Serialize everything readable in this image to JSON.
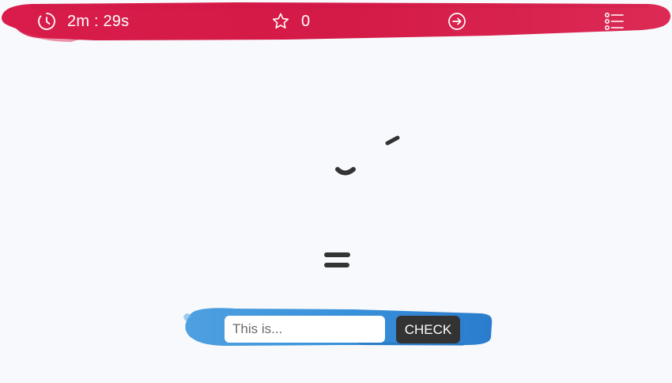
{
  "topbar": {
    "timer_icon": "clock-icon",
    "timer_text": "2m : 29s",
    "score_icon": "star-icon",
    "score_text": "0",
    "next_icon": "arrow-right-circle-icon",
    "menu_icon": "list-menu-icon"
  },
  "answer": {
    "placeholder": "This is...",
    "check_label": "CHECK"
  },
  "colors": {
    "topbar_brush": "#d81b4a",
    "answer_brush": "#2f86d1",
    "stroke": "#333333",
    "page_bg": "#f7f9fc"
  }
}
